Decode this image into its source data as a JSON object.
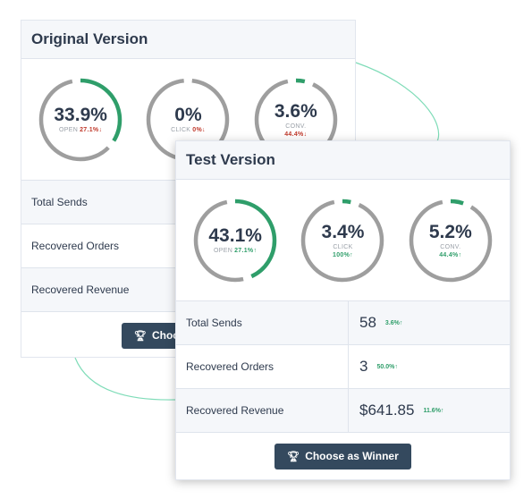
{
  "colors": {
    "accent_green": "#2f9e6a",
    "track_gray": "#9e9e9e",
    "down_red": "#c0392b",
    "button_bg": "#34495e",
    "connector": "#7fdcb8"
  },
  "original": {
    "title": "Original Version",
    "gauges": [
      {
        "value": "33.9%",
        "fraction": 0.339,
        "label": "OPEN",
        "change": "27.1%↓",
        "direction": "down"
      },
      {
        "value": "0%",
        "fraction": 0.0,
        "label": "CLICK",
        "change": "0%↓",
        "direction": "down"
      },
      {
        "value": "3.6%",
        "fraction": 0.036,
        "label": "CONV.",
        "change": "44.4%↓",
        "direction": "down"
      }
    ],
    "rows": [
      {
        "label": "Total Sends"
      },
      {
        "label": "Recovered Orders"
      },
      {
        "label": "Recovered Revenue"
      }
    ],
    "button_label": "Choose as Winner",
    "button_icon": "trophy-icon"
  },
  "test": {
    "title": "Test Version",
    "gauges": [
      {
        "value": "43.1%",
        "fraction": 0.431,
        "label": "OPEN",
        "change": "27.1%↑",
        "direction": "up"
      },
      {
        "value": "3.4%",
        "fraction": 0.034,
        "label": "CLICK",
        "change": "100%↑",
        "direction": "up"
      },
      {
        "value": "5.2%",
        "fraction": 0.052,
        "label": "CONV.",
        "change": "44.4%↑",
        "direction": "up"
      }
    ],
    "rows": [
      {
        "label": "Total Sends",
        "value": "58",
        "change": "3.6%↑"
      },
      {
        "label": "Recovered Orders",
        "value": "3",
        "change": "50.0%↑"
      },
      {
        "label": "Recovered Revenue",
        "value": "$641.85",
        "change": "11.6%↑"
      }
    ],
    "button_label": "Choose as Winner",
    "button_icon": "trophy-icon"
  }
}
